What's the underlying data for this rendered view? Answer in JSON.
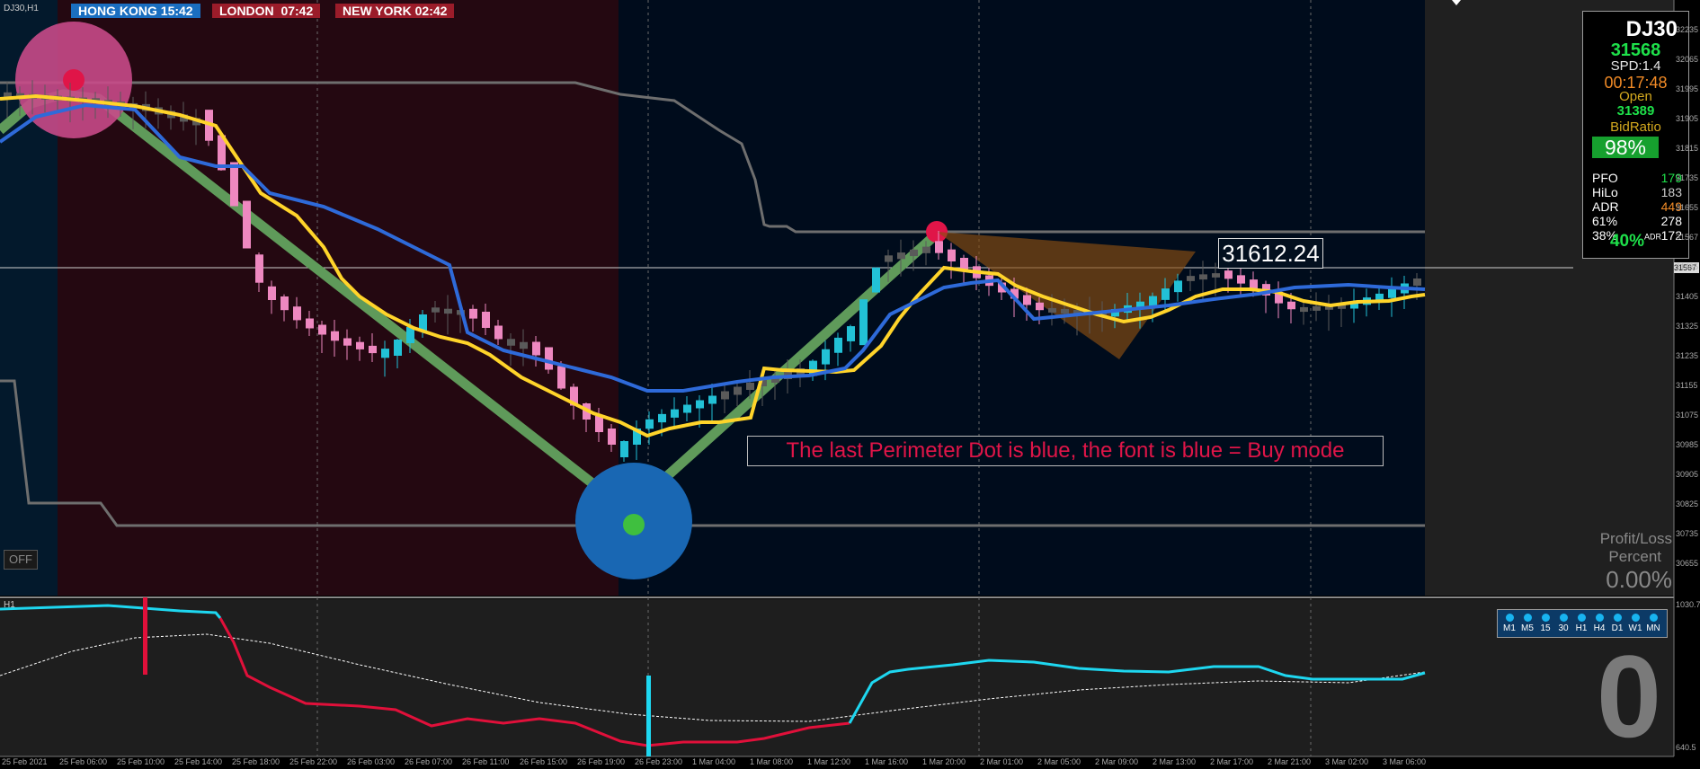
{
  "chart_header": {
    "symbol_tf": "DJ30,H1",
    "sub_label": "H1"
  },
  "clocks": [
    {
      "label": "HONG KONG 15:42",
      "bg": "#1a6ec0"
    },
    {
      "label": "LONDON  07:42",
      "bg": "#9b1c2a"
    },
    {
      "label": "NEW YORK 02:42",
      "bg": "#9b1c2a"
    }
  ],
  "info_panel": {
    "symbol": "DJ30",
    "price": "31568",
    "spread": "SPD:1.4",
    "timer": "00:17:48",
    "open_label": "Open",
    "open_value": "31389",
    "bid_ratio_label": "BidRatio",
    "bid_ratio_value": "98%",
    "rows": [
      {
        "label": "PFO",
        "value": "179",
        "color": "#1ee04a"
      },
      {
        "label": "HiLo",
        "value": "183",
        "color": "#cccccc"
      },
      {
        "label": "ADR",
        "value": "449",
        "color": "#f08a26"
      },
      {
        "label": "61%",
        "value": "278",
        "color": "#ffffff"
      },
      {
        "label": "38%",
        "value": "172",
        "color": "#ffffff"
      }
    ],
    "pct": "40%",
    "pct_suffix": "ADR"
  },
  "off_button": "OFF",
  "annotation": "The last Perimeter Dot is blue, the font is blue = Buy mode",
  "price_box": "31612.24",
  "profit_loss": {
    "title1": "Profit/Loss",
    "title2": "Percent",
    "value": "0.00%"
  },
  "timeframes": [
    "M1",
    "M5",
    "15",
    "30",
    "H1",
    "H4",
    "D1",
    "W1",
    "MN"
  ],
  "big_zero": "0",
  "current_price_tag": "31567",
  "price_axis": [
    "32235",
    "32065",
    "31995",
    "31905",
    "31815",
    "31735",
    "31655",
    "31567",
    "31485",
    "31405",
    "31325",
    "31235",
    "31155",
    "31075",
    "30985",
    "30905",
    "30825",
    "30735",
    "30655"
  ],
  "indicator_axis": [
    "1030.7",
    "640.5"
  ],
  "time_axis": [
    "25 Feb 2021",
    "25 Feb 06:00",
    "25 Feb 10:00",
    "25 Feb 14:00",
    "25 Feb 18:00",
    "25 Feb 22:00",
    "26 Feb 03:00",
    "26 Feb 07:00",
    "26 Feb 11:00",
    "26 Feb 15:00",
    "26 Feb 19:00",
    "26 Feb 23:00",
    "1 Mar 04:00",
    "1 Mar 08:00",
    "1 Mar 12:00",
    "1 Mar 16:00",
    "1 Mar 20:00",
    "2 Mar 01:00",
    "2 Mar 05:00",
    "2 Mar 09:00",
    "2 Mar 13:00",
    "2 Mar 17:00",
    "2 Mar 21:00",
    "3 Mar 02:00",
    "3 Mar 06:00"
  ],
  "colors": {
    "background": "#000c1c",
    "session_shade": "#240811",
    "fast_ma": "#ffd42a",
    "slow_ma": "#2e6ad9",
    "trend_band": "#5f9a5a",
    "bull_candle": "#22c1d6",
    "bear_candle": "#ee88c0",
    "neutral_candle": "#5a5a5a",
    "envelope": "#6e6e6e",
    "indicator_up": "#1ed7f0",
    "indicator_down": "#e0103a"
  }
}
